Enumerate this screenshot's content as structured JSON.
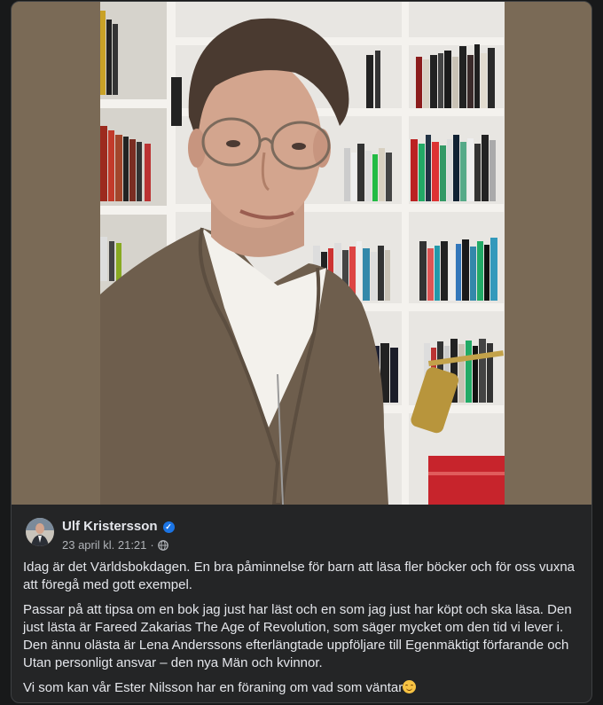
{
  "post": {
    "author": "Ulf Kristersson",
    "verified": true,
    "timestamp": "23 april kl. 21:21",
    "separator": "·",
    "privacy_icon": "globe-icon",
    "paragraphs": [
      "Idag är det Världsbokdagen. En bra påminnelse för barn att läsa fler böcker och för oss vuxna att föregå med gott exempel.",
      "Passar på att tipsa om en bok jag just har läst och en som jag just har köpt och ska läsa. Den just lästa är Fareed Zakarias The Age of Revolution, som säger mycket om den tid vi lever i. Den ännu olästa är Lena Anderssons efterlängtade uppföljare till Egenmäktigt förfarande och Utan personligt ansvar – den nya Män och kvinnor.",
      "Vi som kan vår Ester Nilsson har en föraning om vad som väntar"
    ],
    "emoji": "smiling-face-icon"
  },
  "colors": {
    "background": "#18191a",
    "card": "#242526",
    "text": "#e4e6eb",
    "secondary_text": "#b0b3b8",
    "verified_blue": "#1b74e4"
  }
}
